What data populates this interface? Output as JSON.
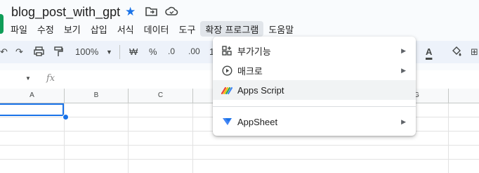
{
  "doc": {
    "title": "blog_post_with_gpt"
  },
  "menu": [
    "파일",
    "수정",
    "보기",
    "삽입",
    "서식",
    "데이터",
    "도구",
    "확장 프로그램",
    "도움말"
  ],
  "toolbar": {
    "zoom": "100%",
    "currency": "₩",
    "percent": "%",
    "dec_less": ".0",
    "dec_more": ".00",
    "more": "1"
  },
  "formula_bar": {
    "fx": "fx"
  },
  "columns": [
    "A",
    "B",
    "C",
    "G"
  ],
  "dropdown": {
    "items": [
      {
        "label": "부가기능",
        "icon": "addon-icon",
        "has_submenu": true
      },
      {
        "label": "매크로",
        "icon": "play-circle-icon",
        "has_submenu": true
      },
      {
        "label": "Apps Script",
        "icon": "apps-script-icon",
        "has_submenu": false
      },
      {
        "label": "AppSheet",
        "icon": "appsheet-icon",
        "has_submenu": true
      }
    ]
  },
  "colors": {
    "accent": "#1a73e8",
    "highlight": "#f1f3f4"
  }
}
